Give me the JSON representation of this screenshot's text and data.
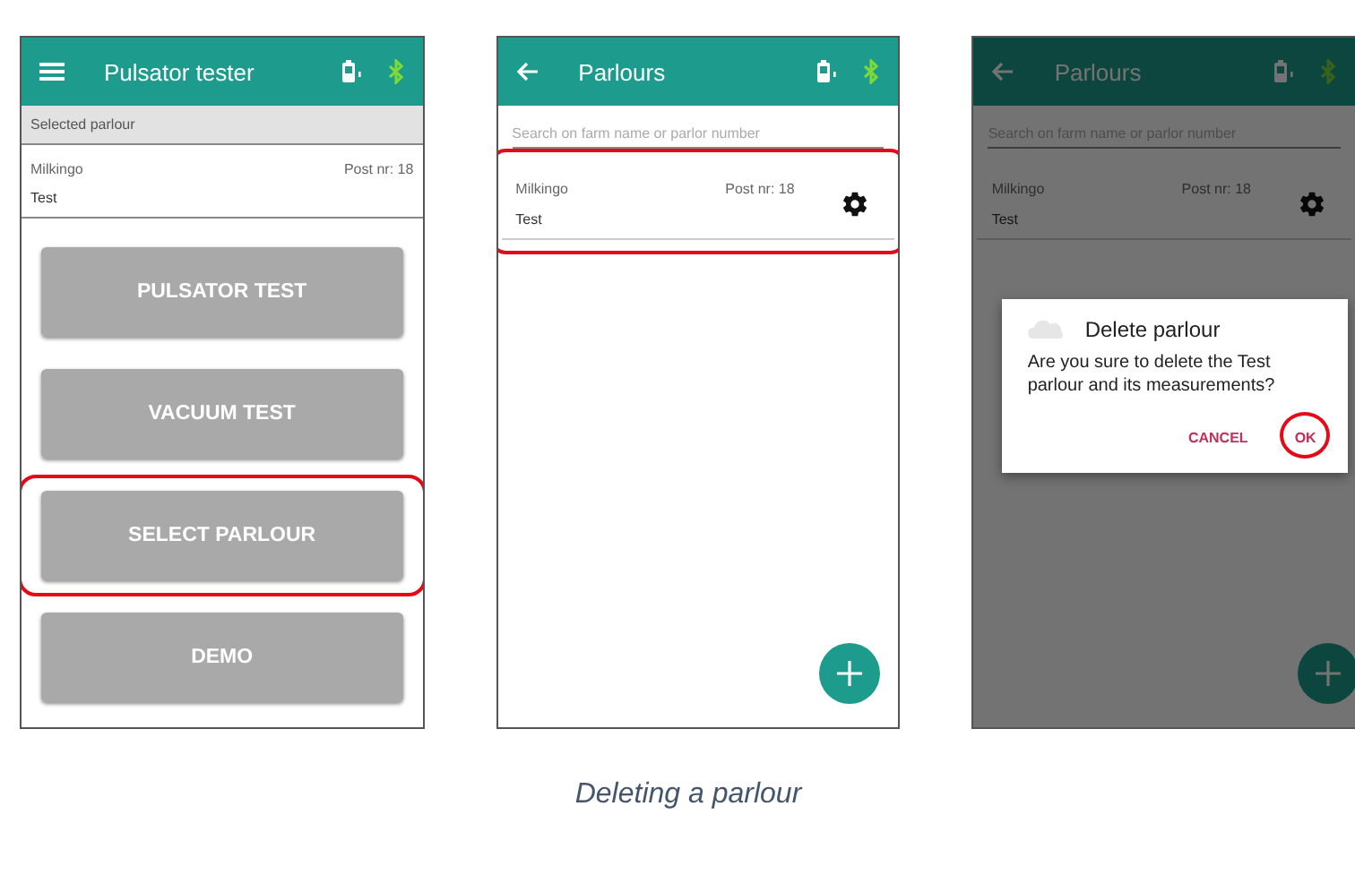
{
  "screens": [
    {
      "kind": "home",
      "title": "Pulsator tester",
      "selected_label": "Selected parlour",
      "parlour": {
        "farm": "Milkingo",
        "post": "Post nr: 18",
        "name": "Test"
      },
      "buttons": [
        {
          "label": "PULSATOR TEST",
          "highlighted": false
        },
        {
          "label": "VACUUM TEST",
          "highlighted": false
        },
        {
          "label": "SELECT PARLOUR",
          "highlighted": true
        },
        {
          "label": "DEMO",
          "highlighted": false
        }
      ]
    },
    {
      "kind": "list",
      "title": "Parlours",
      "search_placeholder": "Search on farm name or parlor number",
      "parlours": [
        {
          "farm": "Milkingo",
          "post": "Post nr: 18",
          "name": "Test",
          "highlighted": true
        }
      ]
    },
    {
      "kind": "list",
      "title": "Parlours",
      "search_placeholder": "Search on farm name or parlor number",
      "parlours": [
        {
          "farm": "Milkingo",
          "post": "Post nr: 18",
          "name": "Test",
          "highlighted": false
        }
      ],
      "dialog": {
        "title": "Delete parlour",
        "message": "Are you sure to delete the Test parlour and its measurements?",
        "buttons": [
          {
            "label": "CANCEL",
            "highlighted": false
          },
          {
            "label": "OK",
            "highlighted": true
          }
        ]
      }
    }
  ],
  "caption": "Deleting a parlour"
}
